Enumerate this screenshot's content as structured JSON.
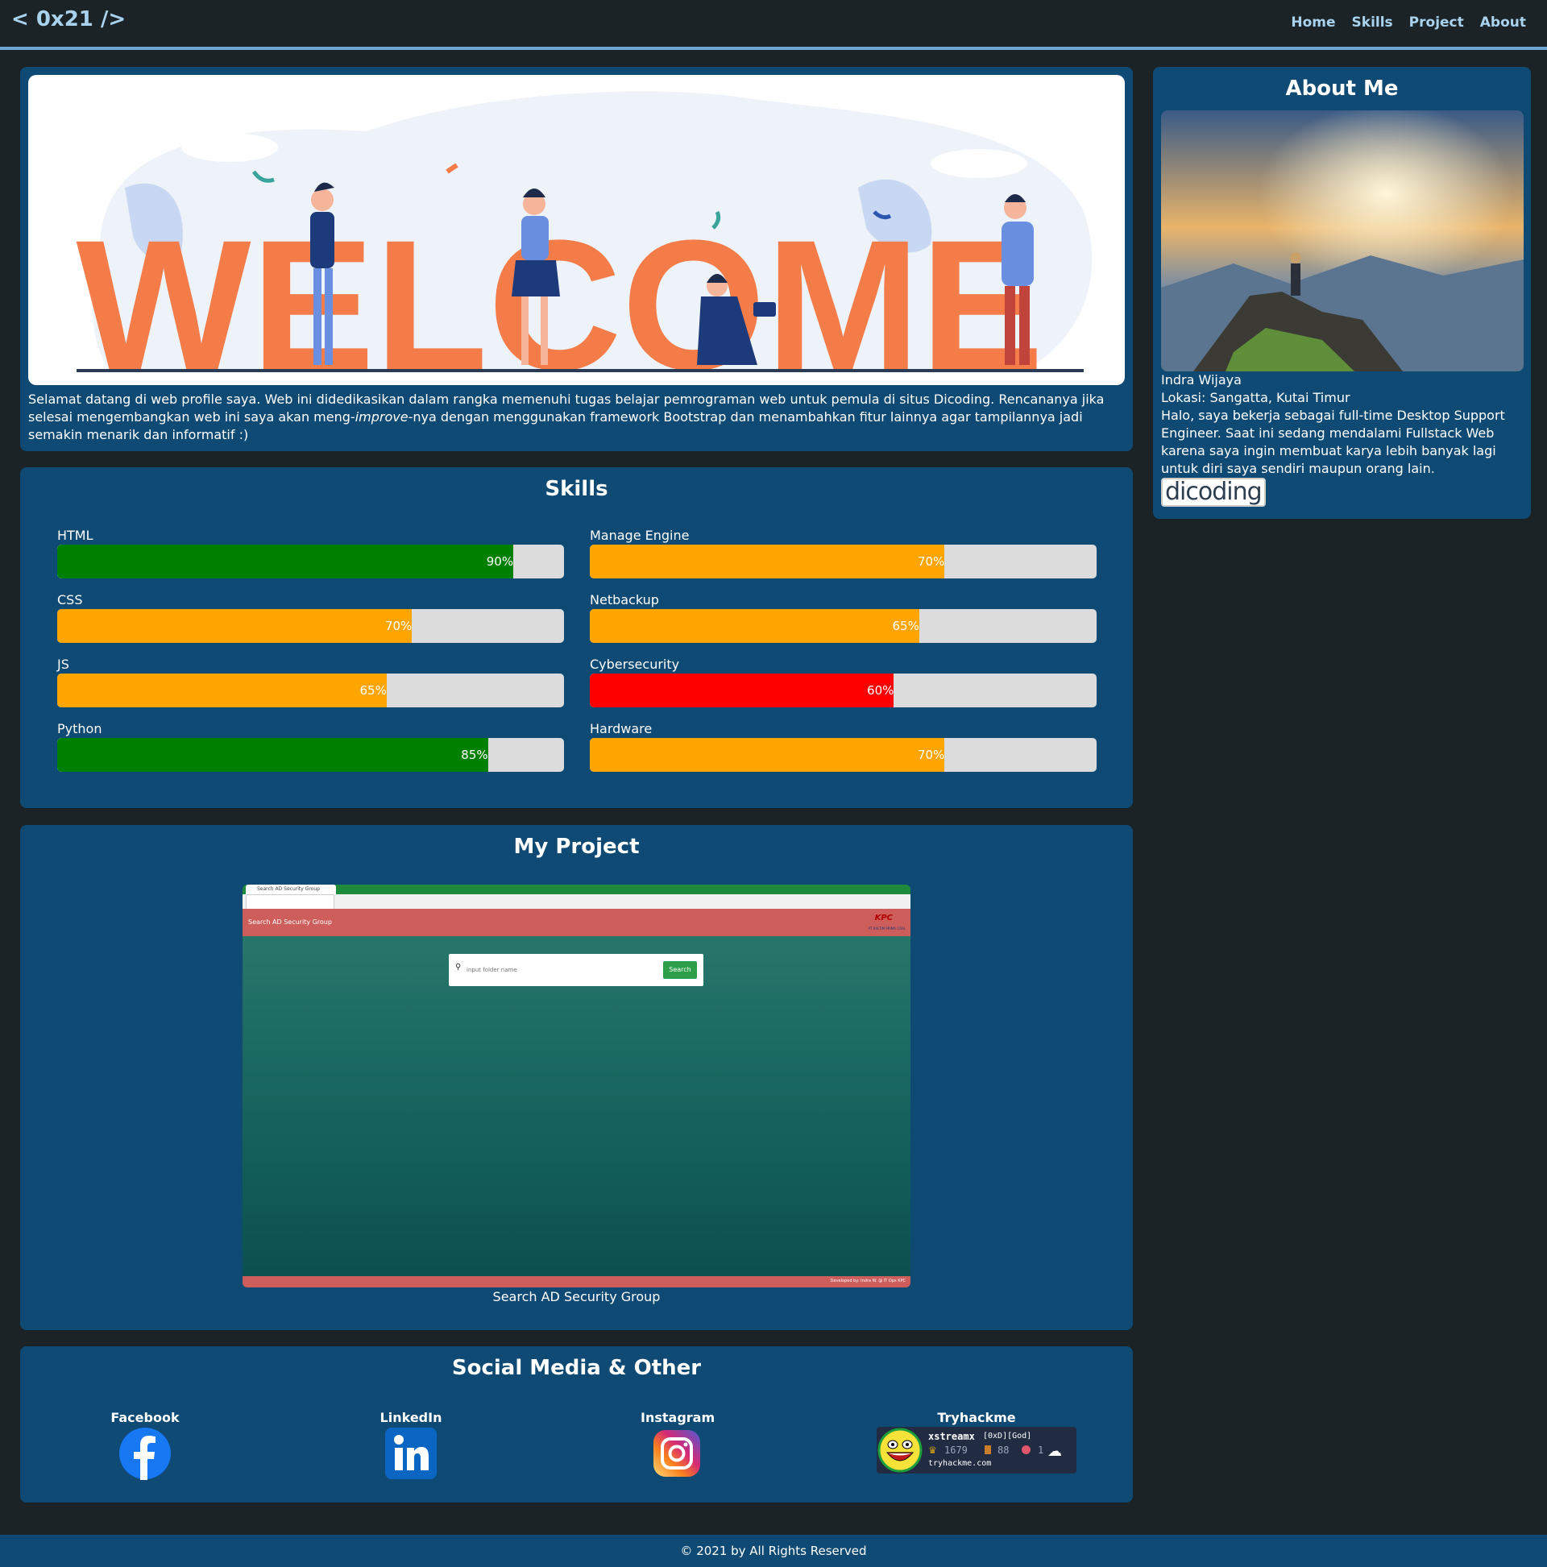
{
  "nav": {
    "brand": "< 0x21 />",
    "links": [
      "Home",
      "Skills",
      "Project",
      "About"
    ]
  },
  "welcome": {
    "banner_word": "WELCOME",
    "intro_before": "Selamat datang di web profile saya. Web ini didedikasikan dalam rangka memenuhi tugas belajar pemrograman web untuk pemula di situs Dicoding. Rencananya jika selesai mengembangkan web ini saya akan meng-",
    "intro_em": "improve",
    "intro_after": "-nya dengan menggunakan framework Bootstrap dan menambahkan fitur lainnya agar tampilannya jadi semakin menarik dan informatif :)"
  },
  "about": {
    "title": "About Me",
    "name": "Indra Wijaya",
    "location": "Lokasi: Sangatta, Kutai Timur",
    "bio": "Halo, saya bekerja sebagai full-time Desktop Support Engineer. Saat ini sedang mendalami Fullstack Web karena saya ingin membuat karya lebih banyak lagi untuk diri saya sendiri maupun orang lain.",
    "badge": "dicoding"
  },
  "skills": {
    "title": "Skills",
    "items": [
      {
        "name": "HTML",
        "percent": 90,
        "label": "90%",
        "color": "#008000"
      },
      {
        "name": "Manage Engine",
        "percent": 70,
        "label": "70%",
        "color": "#ffa500"
      },
      {
        "name": "CSS",
        "percent": 70,
        "label": "70%",
        "color": "#ffa500"
      },
      {
        "name": "Netbackup",
        "percent": 65,
        "label": "65%",
        "color": "#ffa500"
      },
      {
        "name": "JS",
        "percent": 65,
        "label": "65%",
        "color": "#ffa500"
      },
      {
        "name": "Cybersecurity",
        "percent": 60,
        "label": "60%",
        "color": "#ff0000"
      },
      {
        "name": "Python",
        "percent": 85,
        "label": "85%",
        "color": "#008000"
      },
      {
        "name": "Hardware",
        "percent": 70,
        "label": "70%",
        "color": "#ffa500"
      }
    ]
  },
  "project": {
    "title": "My Project",
    "caption": "Search AD Security Group",
    "screenshot": {
      "tab_title": "Search AD Security Group",
      "header_title": "Search AD Security Group",
      "logo": "KPC",
      "logo_sub": "PT KALTIM PRIMA COAL",
      "search_placeholder": "input folder name",
      "search_button": "Search",
      "footer_text": "Developed by: Indra W. @ IT Ops KPC"
    }
  },
  "social": {
    "title": "Social Media & Other",
    "items": [
      {
        "label": "Facebook",
        "icon": "facebook-icon"
      },
      {
        "label": "LinkedIn",
        "icon": "linkedin-icon"
      },
      {
        "label": "Instagram",
        "icon": "instagram-icon"
      },
      {
        "label": "Tryhackme",
        "icon": "tryhackme-badge"
      }
    ],
    "thm": {
      "user": "xstreamx",
      "rank": "[0xD][God]",
      "points": "1679",
      "badges": "88",
      "rooms": "1",
      "site": "tryhackme.com"
    }
  },
  "footer": {
    "text": "© 2021 by All Rights Reserved"
  },
  "colors": {
    "page_bg": "#1b2327",
    "card_bg": "#0f4a74",
    "nav_link": "#a9d2ee",
    "welcome_orange": "#f47c48",
    "bar_track": "#dcdcdc"
  }
}
